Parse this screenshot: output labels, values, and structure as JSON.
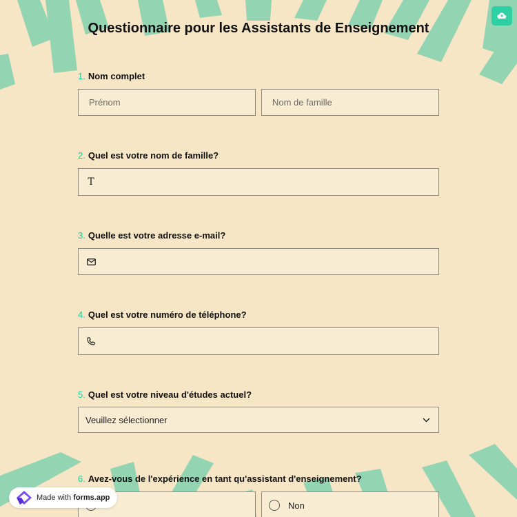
{
  "title": "Questionnaire pour les Assistants de Enseignement",
  "colors": {
    "background": "#f6e6c5",
    "stripe": "#8fd3b2",
    "accent": "#27c49a",
    "field_bg": "#f8ecd3"
  },
  "save_icon": "cloud-upload-icon",
  "questions": [
    {
      "num": "1.",
      "label": "Nom complet",
      "first_placeholder": "Prénom",
      "last_placeholder": "Nom de famille"
    },
    {
      "num": "2.",
      "label": "Quel est votre nom de famille?",
      "icon": "text-icon",
      "icon_glyph": "T"
    },
    {
      "num": "3.",
      "label": "Quelle est votre adresse e-mail?",
      "icon": "envelope-icon"
    },
    {
      "num": "4.",
      "label": "Quel est votre numéro de téléphone?",
      "icon": "phone-icon"
    },
    {
      "num": "5.",
      "label": "Quel est votre niveau d'études actuel?",
      "selected": "Veuillez sélectionner"
    },
    {
      "num": "6.",
      "label": "Avez-vous de l'expérience en tant qu'assistant d'enseignement?",
      "options": [
        "",
        "Non"
      ]
    }
  ],
  "badge": {
    "prefix": "Made with ",
    "brand": "forms.app"
  }
}
